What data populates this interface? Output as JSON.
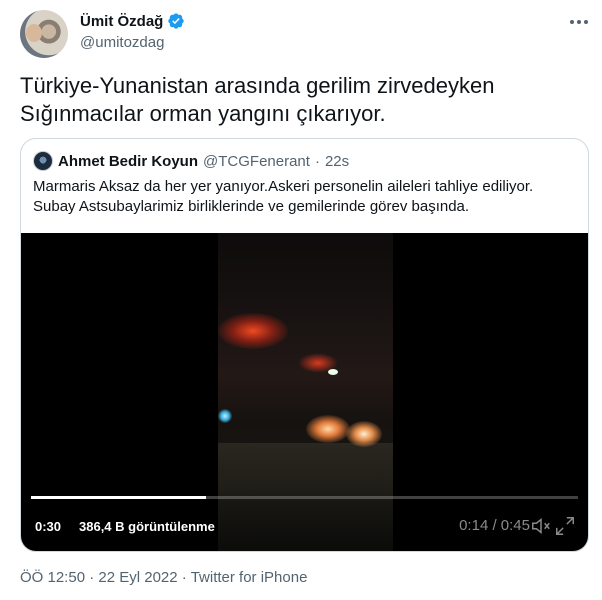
{
  "author": {
    "display_name": "Ümit Özdağ",
    "handle": "@umitozdag",
    "verified": true,
    "avatar_icon": "user-avatar"
  },
  "tweet": {
    "text_line1": "Türkiye-Yunanistan arasında gerilim zirvedeyken",
    "text_line2": "Sığınmacılar orman yangını çıkarıyor."
  },
  "quoted_tweet": {
    "display_name": "Ahmet Bedir Koyun",
    "handle": "@TCGFenerant",
    "separator": "·",
    "time": "22s",
    "text_line1": "Marmaris Aksaz da her yer yanıyor.Askeri personelin aileleri tahliye ediliyor.",
    "text_line2": "Subay Astsubaylarimiz birliklerinde ve gemilerinde görev başında."
  },
  "video": {
    "elapsed": "0:30",
    "views": "386,4 B görüntülenme",
    "remaining": "0:14 / 0:45",
    "progress": 0.32,
    "background_color": "#000000"
  },
  "footer": {
    "time": "ÖÖ 12:50",
    "separator1": "·",
    "date": "22 Eyl 2022",
    "separator2": "·",
    "source": "Twitter for iPhone"
  },
  "colors": {
    "verified": "#1d9bf0",
    "secondary_text": "#536471",
    "border": "#cfd9de"
  }
}
